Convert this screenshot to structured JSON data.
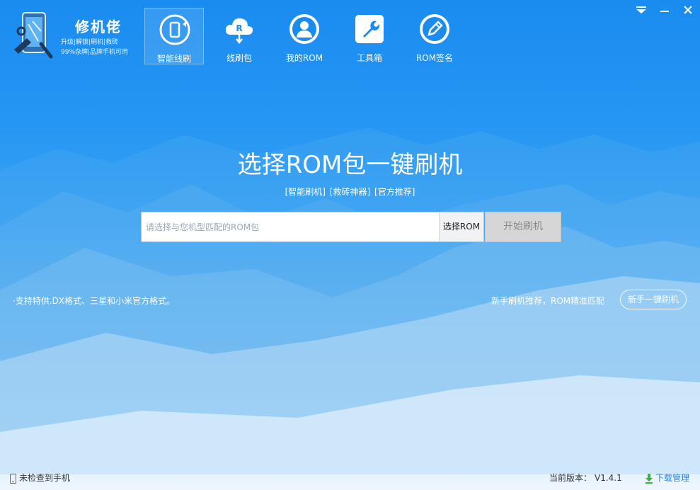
{
  "app": {
    "name": "修机佬",
    "tagline_1": "升级|解锁|刷机|救砖",
    "tagline_2": "99%杂牌|品牌手机可用"
  },
  "tabs": [
    {
      "label": "智能线刷",
      "icon": "phone-refresh-icon",
      "active": true
    },
    {
      "label": "线刷包",
      "icon": "cloud-download-icon",
      "active": false
    },
    {
      "label": "我的ROM",
      "icon": "user-icon",
      "active": false
    },
    {
      "label": "工具箱",
      "icon": "wrench-icon",
      "active": false
    },
    {
      "label": "ROM签名",
      "icon": "pen-icon",
      "active": false
    }
  ],
  "window_controls": [
    "menu-icon",
    "minimize-icon",
    "close-icon"
  ],
  "main": {
    "headline": "选择ROM包一键刷机",
    "links": [
      "[智能刷机]",
      "[救砖神器]",
      "[官方推荐]"
    ],
    "search_placeholder": "请选择与您机型匹配的ROM包",
    "search_value": "",
    "choose_label": "选择ROM",
    "start_label": "开始刷机",
    "support_text": "·支持特供.DX格式、三星和小米官方格式。",
    "newbie_text": "新手刷机推荐，ROM精准匹配",
    "newbie_button": "新手一键刷机"
  },
  "status": {
    "phone": "未检查到手机",
    "version_label": "当前版本：",
    "version": "V1.4.1",
    "download": "下载管理"
  },
  "colors": {
    "accent": "#1a8cf0",
    "link": "#2b83d8",
    "download_icon": "#3cb33c"
  }
}
